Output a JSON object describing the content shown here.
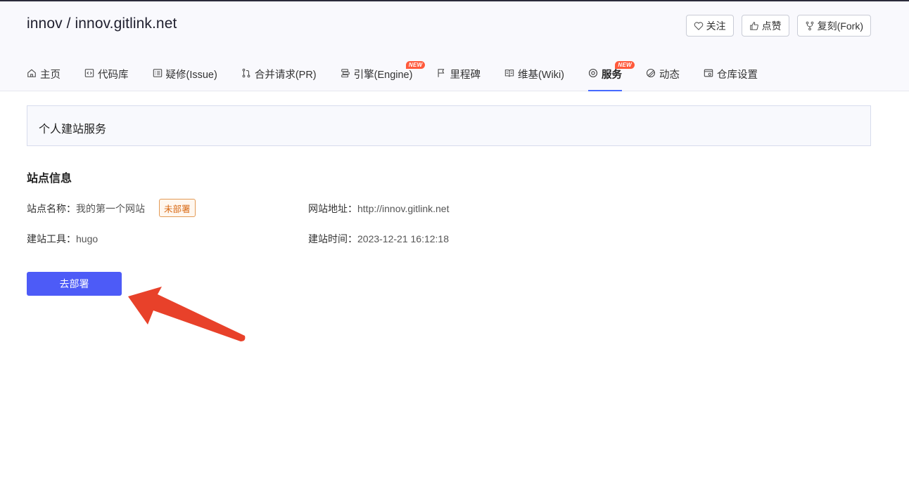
{
  "repo": {
    "title": "innov / innov.gitlink.net"
  },
  "actions": [
    {
      "label": "关注",
      "icon": "heart-icon"
    },
    {
      "label": "点赞",
      "icon": "thumbs-up-icon"
    },
    {
      "label": "复刻(Fork)",
      "icon": "fork-icon"
    }
  ],
  "tabs": [
    {
      "label": "主页",
      "icon": "home-icon"
    },
    {
      "label": "代码库",
      "icon": "code-icon"
    },
    {
      "label": "疑修(Issue)",
      "icon": "issue-icon"
    },
    {
      "label": "合并请求(PR)",
      "icon": "merge-icon"
    },
    {
      "label": "引擎(Engine)",
      "icon": "engine-icon",
      "badge": "NEW"
    },
    {
      "label": "里程碑",
      "icon": "flag-icon"
    },
    {
      "label": "维基(Wiki)",
      "icon": "book-icon"
    },
    {
      "label": "服务",
      "icon": "service-icon",
      "badge": "NEW",
      "active": true
    },
    {
      "label": "动态",
      "icon": "activity-icon"
    },
    {
      "label": "仓库设置",
      "icon": "settings-icon"
    }
  ],
  "panel": {
    "title": "个人建站服务"
  },
  "site_info": {
    "section_title": "站点信息",
    "name_label": "站点名称：",
    "name_value": "我的第一个网站",
    "status": "未部署",
    "url_label": "网站地址：",
    "url_value": "http://innov.gitlink.net",
    "tool_label": "建站工具：",
    "tool_value": "hugo",
    "time_label": "建站时间：",
    "time_value": "2023-12-21 16:12:18"
  },
  "deploy_button": {
    "label": "去部署"
  },
  "colors": {
    "accent": "#466aff",
    "button": "#4d5bf7",
    "arrow": "#e8412a",
    "status": "#d86a15"
  }
}
